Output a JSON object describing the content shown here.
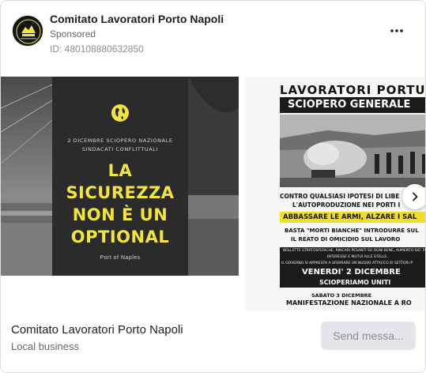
{
  "advertiser": {
    "name": "Comitato Lavoratori Porto Napoli",
    "sponsored_label": "Sponsored",
    "ad_id": "ID: 480108880632850",
    "category": "Local business"
  },
  "actions": {
    "more_icon": "more-horizontal-icon",
    "send_button": "Send messa...",
    "next_icon": "chevron-right-icon"
  },
  "slide1": {
    "subtitle_line1": "2 DICEMBRE SCIOPERO NAZIONALE",
    "subtitle_line2": "SINDACATI CONFLITTUALI",
    "headline": [
      "LA",
      "SICUREZZA",
      "NON È UN",
      "OPTIONAL"
    ],
    "footer": "Port of Naples",
    "icon": "globe-icon",
    "colors": {
      "headline": "#f2e541",
      "icon": "#f2e541"
    }
  },
  "slide2": {
    "title": "LAVORATORI PORTUA",
    "banner": "SCIOPERO GENERALE",
    "lines": [
      "CONTRO QUALSIASI IPOTESI DI LIBE",
      "L'AUTOPRODUZIONE  NEI PORTI I"
    ],
    "highlight": "ABBASSARE LE ARMI, ALZARE I SAL",
    "line3": "BASTA \"MORTI BIANCHE\" INTRODURRE SUL",
    "line4": "IL REATO DI OMICIDIO SUL LAVORO",
    "small_text": "BOLLETTE STRATOSFERICHE, RINCARI PESANTI SU OGNI BENE, AUMENTO DEI TA",
    "small_text2": "INTERESSE E MUTUI ALLE STELLE..",
    "small_text3": "IL GOVERNO SI APPRESTA A SFERRARE UN NUOVO ATTACCO AI SETTORI P",
    "date_banner": "VENERDI' 2 DICEMBRE",
    "date_sub": "SCIOPERIAMO UNITI",
    "saturday": "SABATO 3 DICEMBRE",
    "manifestation": "MANIFESTAZIONE NAZIONALE A RO",
    "colors": {
      "highlight_bg": "#f0de2a"
    }
  }
}
